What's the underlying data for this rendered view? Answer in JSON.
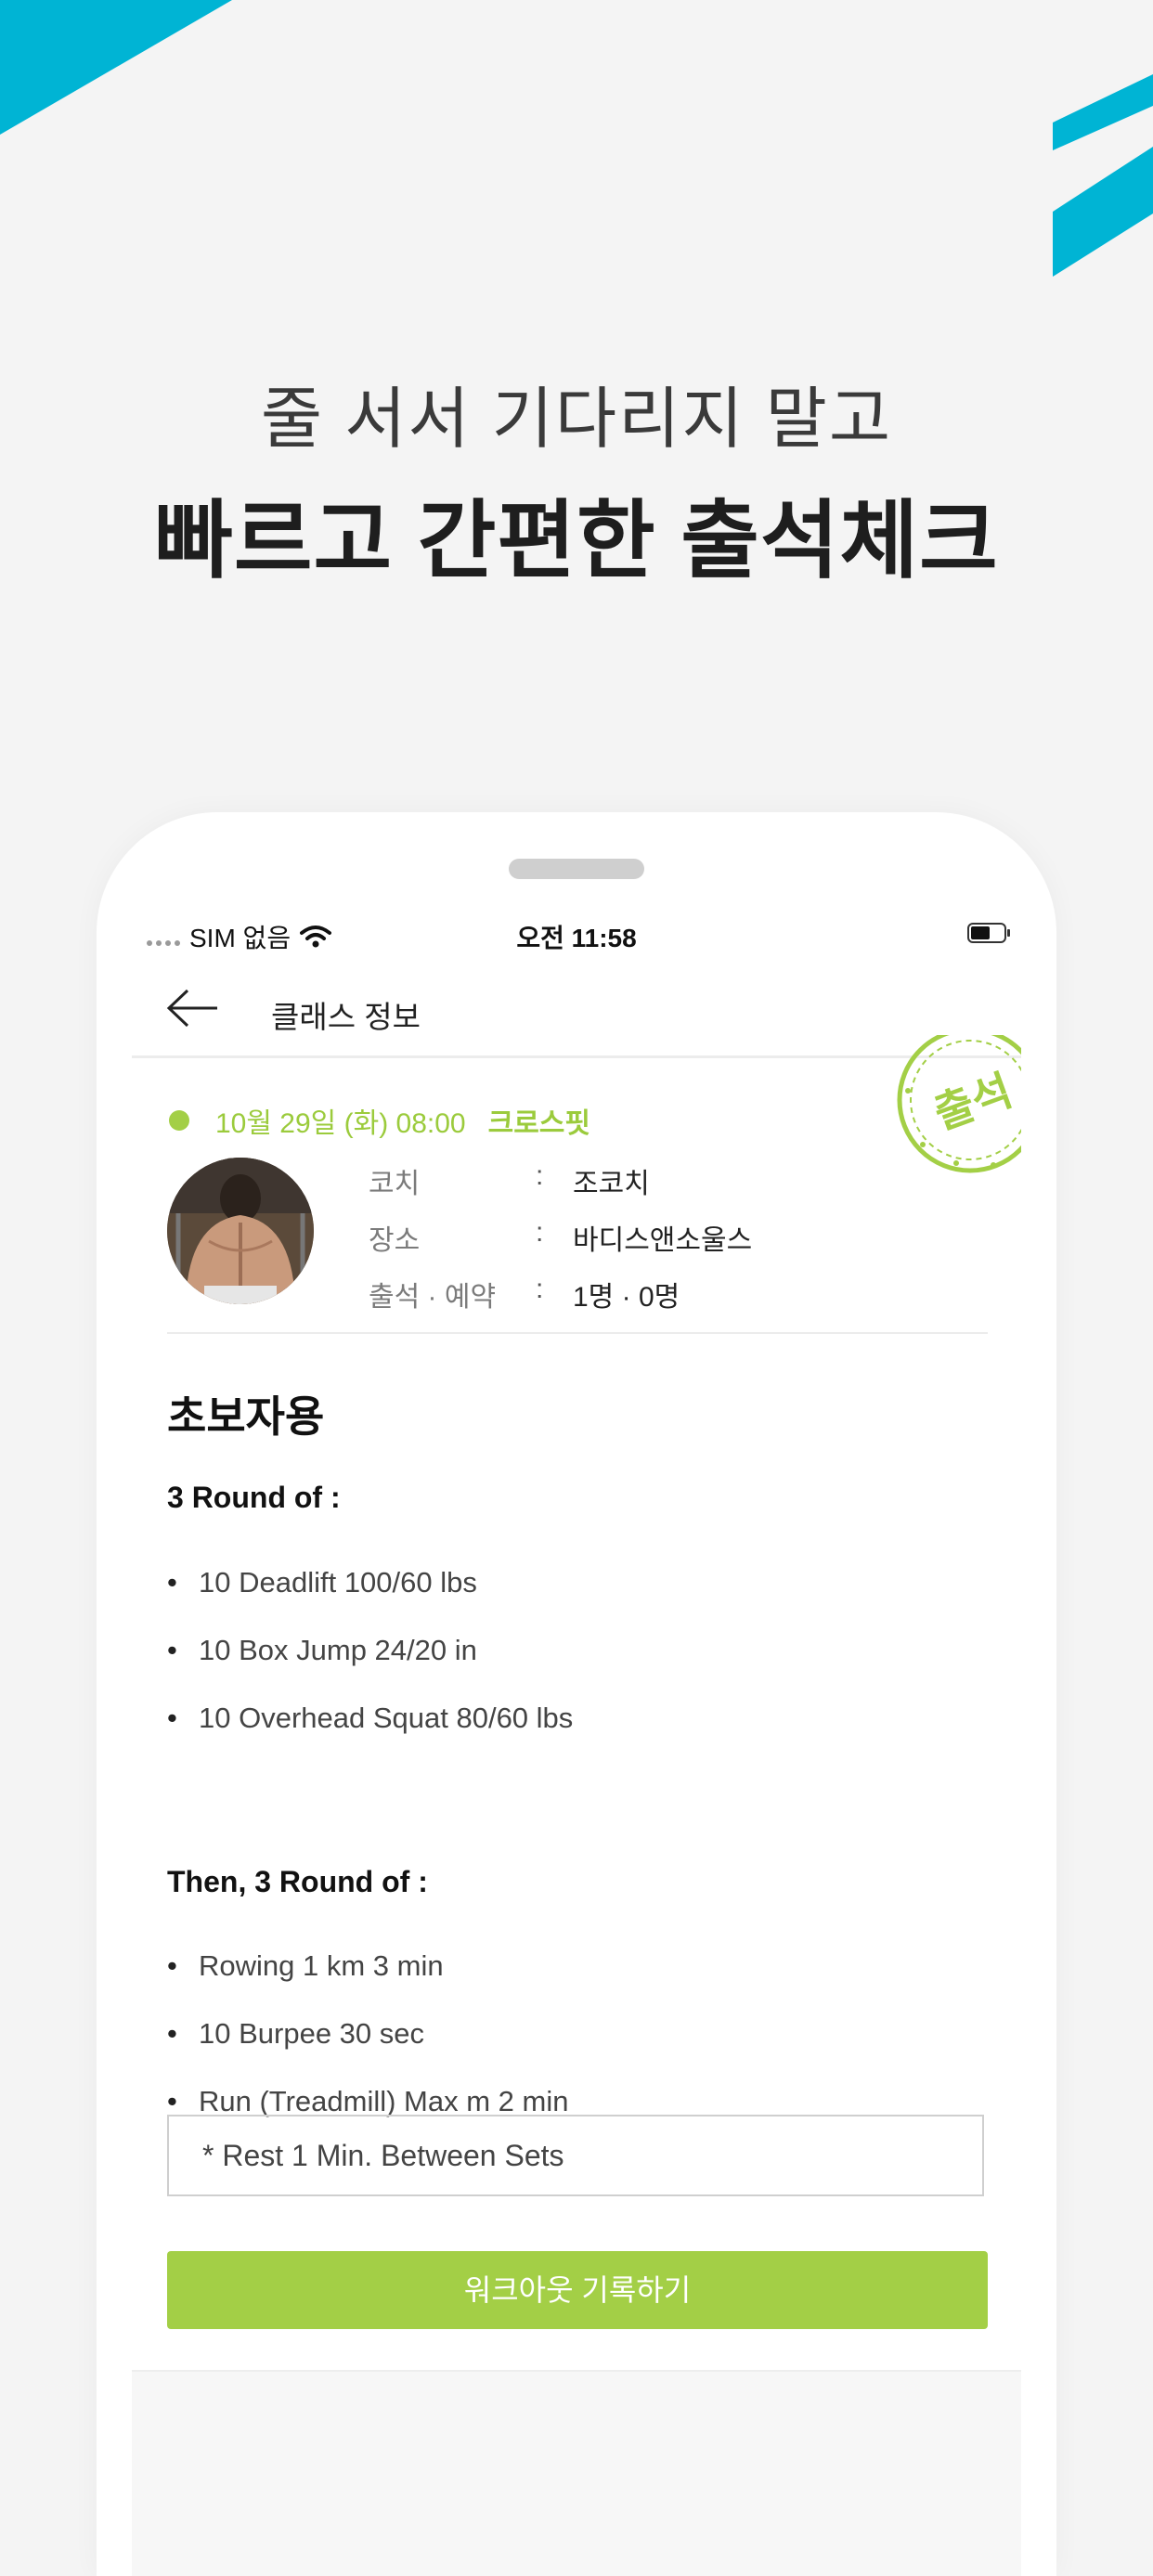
{
  "colors": {
    "background": "#f4f4f4",
    "accent_cyan": "#00b4d4",
    "accent_green": "#a3cf46",
    "text_dark": "#1e1e1e"
  },
  "headline": {
    "line1": "줄 서서 기다리지 말고",
    "line2": "빠르고 간편한 출석체크"
  },
  "statusbar": {
    "carrier": "SIM 없음",
    "time": "오전 11:58",
    "icons": [
      "signal-dots-icon",
      "wifi-icon",
      "battery-icon"
    ]
  },
  "navbar": {
    "title": "클래스 정보",
    "back_icon": "arrow-left-icon"
  },
  "class_info": {
    "date": "10월 29일 (화) 08:00",
    "type": "크로스핏",
    "stamp_label": "출석",
    "rows": [
      {
        "key": "코치",
        "value": "조코치"
      },
      {
        "key": "장소",
        "value": "바디스앤소울스"
      },
      {
        "key": "출석 · 예약",
        "value": "1명 · 0명"
      }
    ]
  },
  "workout": {
    "title": "초보자용",
    "sections": [
      {
        "heading": "3 Round of :",
        "items": [
          "10 Deadlift 100/60 lbs",
          "10 Box Jump 24/20 in",
          "10 Overhead Squat 80/60 lbs"
        ]
      },
      {
        "heading": "Then, 3 Round of :",
        "items": [
          "Rowing 1 km 3 min",
          "10 Burpee 30 sec",
          "Run (Treadmill) Max m 2 min"
        ]
      }
    ],
    "note": "* Rest 1 Min. Between Sets"
  },
  "record_button_label": "워크아웃 기록하기"
}
